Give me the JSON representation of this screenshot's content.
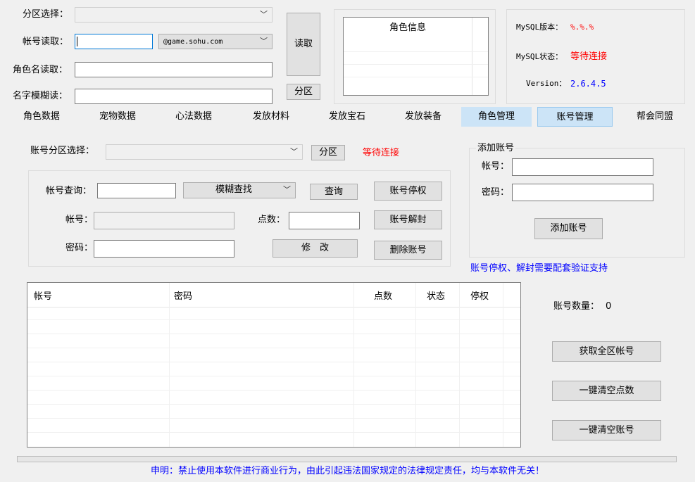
{
  "top": {
    "zone_label": "分区选择：",
    "account_read_label": "帐号读取：",
    "domain_value": "@game.sohu.com",
    "role_name_label": "角色名读取：",
    "fuzzy_name_label": "名字模糊读：",
    "read_button": "读取",
    "zone_button": "分区",
    "role_info_header": "角色信息",
    "mysql_version_label": "MySQL版本：",
    "mysql_version_value": "%.%.%",
    "mysql_status_label": "MySQL状态：",
    "mysql_status_value": "等待连接",
    "version_label": "Version：",
    "version_value": "2.6.4.5"
  },
  "tabs": [
    "角色数据",
    "宠物数据",
    "心法数据",
    "发放材料",
    "发放宝石",
    "发放装备",
    "角色管理",
    "账号管理",
    "帮会同盟"
  ],
  "account": {
    "zone_label": "账号分区选择：",
    "zone_button": "分区",
    "status": "等待连接",
    "query_label": "帐号查询：",
    "fuzzy_combo": "模糊查找",
    "query_button": "查询",
    "suspend_button": "账号停权",
    "account_label": "帐号：",
    "points_label": "点数：",
    "unseal_button": "账号解封",
    "password_label": "密码：",
    "modify_button": "修　改",
    "delete_button": "删除账号",
    "add_group_title": "添加账号",
    "add_account_label": "帐号：",
    "add_password_label": "密码：",
    "add_button": "添加账号",
    "note": "账号停权、解封需要配套验证支持"
  },
  "table": {
    "columns": [
      "帐号",
      "密码",
      "点数",
      "状态",
      "停权"
    ]
  },
  "right": {
    "count_label": "账号数量：",
    "count_value": "0",
    "get_all_button": "获取全区帐号",
    "clear_points_button": "一键清空点数",
    "clear_accounts_button": "一键清空账号"
  },
  "footer": {
    "disclaimer": "申明：禁止使用本软件进行商业行为，由此引起违法国家规定的法律规定责任，均与本软件无关！"
  }
}
